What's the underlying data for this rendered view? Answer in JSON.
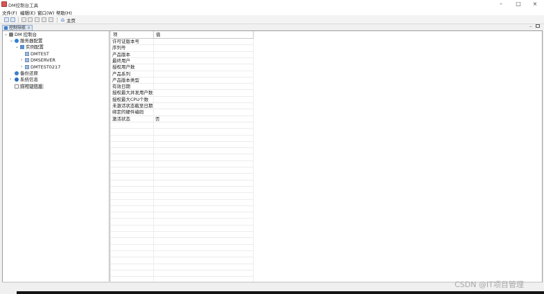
{
  "window": {
    "title": "DM控制台工具"
  },
  "menu": [
    {
      "label": "文件(F)"
    },
    {
      "label": "编辑(E)"
    },
    {
      "label": "窗口(W)"
    },
    {
      "label": "帮助(H)"
    }
  ],
  "toolbar": {
    "home_label": "主页"
  },
  "tab": {
    "label": "控制导航"
  },
  "tree": {
    "root": "DM 控制台",
    "service_config": "服务器配置",
    "instance_config": "实例配置",
    "instances": [
      "DMTEST",
      "DMSERVER",
      "DMTEST0217"
    ],
    "backup": "备份还原",
    "system_info": "系统信息",
    "license_info": "许可证信息"
  },
  "grid": {
    "columns": [
      "项",
      "值"
    ],
    "rows": [
      {
        "item": "许可证版本号",
        "value": ""
      },
      {
        "item": "序列号",
        "value": ""
      },
      {
        "item": "产品版本",
        "value": ""
      },
      {
        "item": "最终用户",
        "value": ""
      },
      {
        "item": "授权用户数",
        "value": ""
      },
      {
        "item": "产品系列",
        "value": ""
      },
      {
        "item": "产品版本类型",
        "value": ""
      },
      {
        "item": "有效日期",
        "value": ""
      },
      {
        "item": "授权最大并发用户数",
        "value": ""
      },
      {
        "item": "授权最大CPU个数",
        "value": ""
      },
      {
        "item": "未激活状态截至日期",
        "value": ""
      },
      {
        "item": "绑定的硬件编码",
        "value": ""
      },
      {
        "item": "激活状态",
        "value": "否"
      }
    ]
  },
  "watermark": "CSDN @IT项目管理",
  "colors": {
    "accent": "#2b6cc4",
    "selection": "#dcdcdc"
  },
  "icons": [
    "app-icon",
    "home-icon",
    "server-icon",
    "instance-icon",
    "backup-icon",
    "info-icon",
    "license-icon"
  ]
}
